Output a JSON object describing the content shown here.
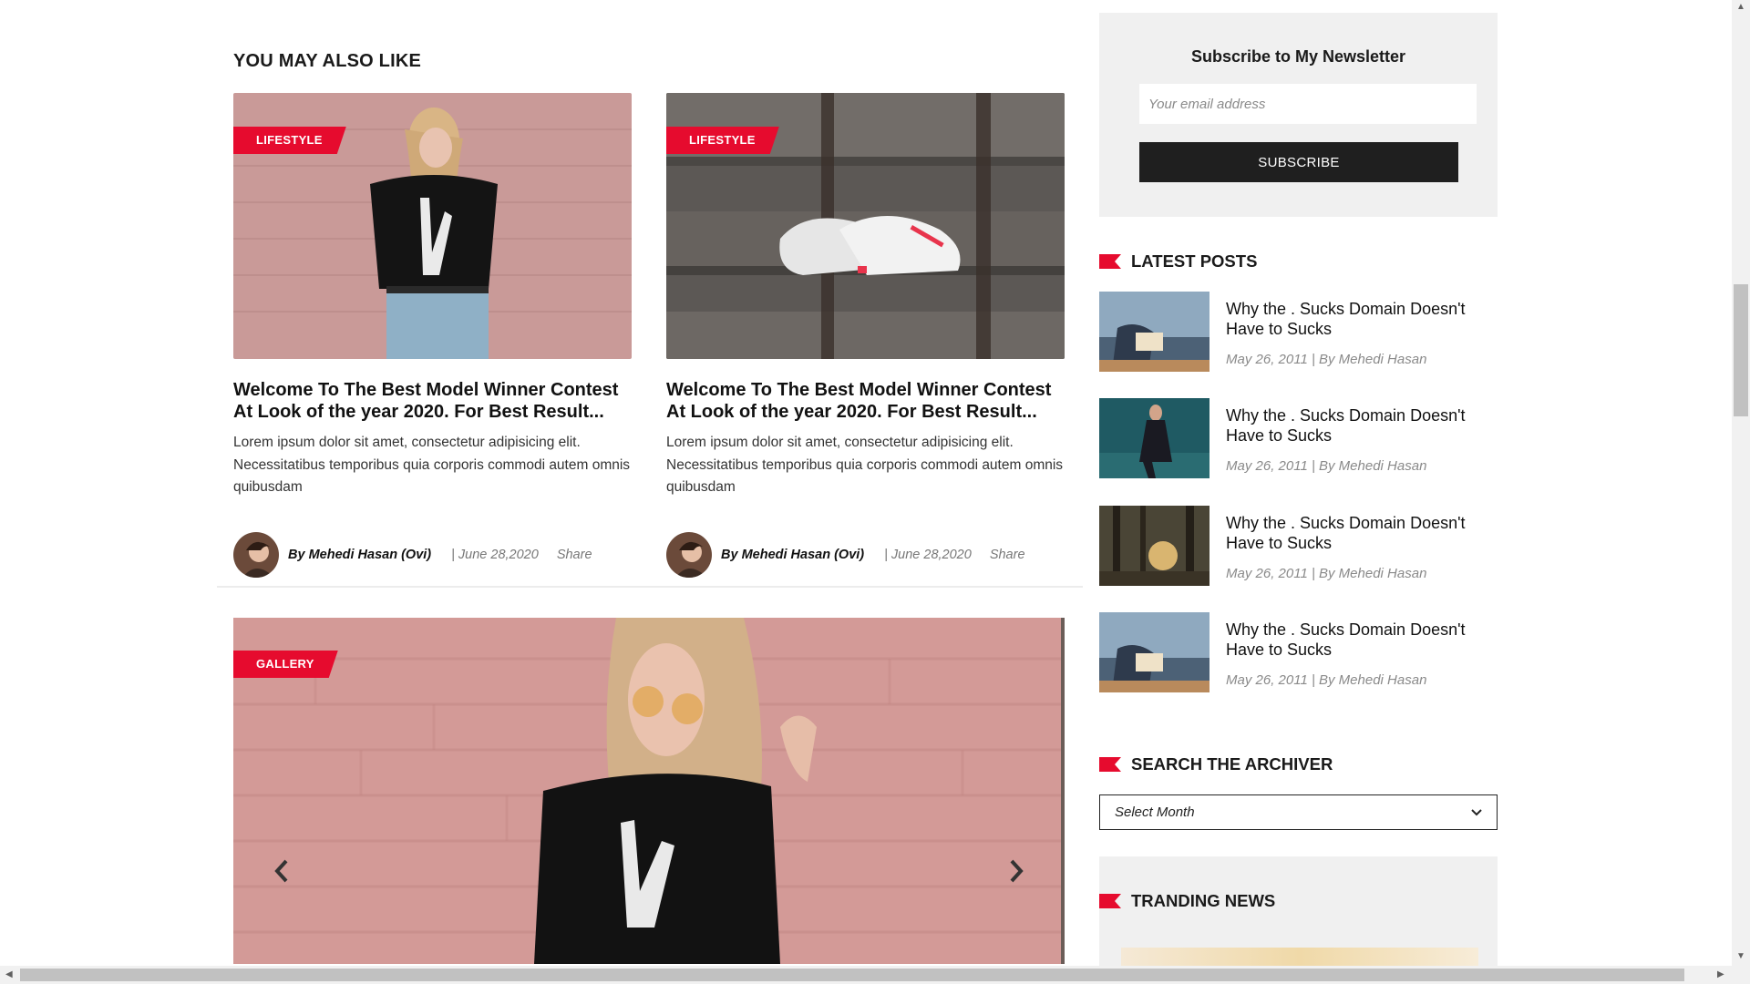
{
  "related": {
    "heading": "YOU MAY ALSO LIKE",
    "cards": [
      {
        "category": "LIFESTYLE",
        "title": "Welcome To The Best Model Winner Contest At Look of the year 2020. For Best Result...",
        "excerpt": "Lorem ipsum dolor sit amet, consectetur adipisicing elit. Necessitatibus temporibus quia corporis commodi autem omnis quibusdam",
        "author": "By Mehedi Hasan (Ovi)",
        "date": "| June 28,2020",
        "share": "Share"
      },
      {
        "category": "LIFESTYLE",
        "title": "Welcome To The Best Model Winner Contest At Look of the year 2020. For Best Result...",
        "excerpt": "Lorem ipsum dolor sit amet, consectetur adipisicing elit. Necessitatibus temporibus quia corporis commodi autem omnis quibusdam",
        "author": "By Mehedi Hasan (Ovi)",
        "date": "| June 28,2020",
        "share": "Share"
      }
    ]
  },
  "gallery": {
    "category": "GALLERY",
    "prev_icon": "chevron-left-icon",
    "next_icon": "chevron-right-icon"
  },
  "newsletter": {
    "title": "Subscribe to My Newsletter",
    "email_placeholder": "Your email address",
    "button_label": "SUBSCRIBE"
  },
  "latest_posts": {
    "title": "LATEST POSTS",
    "items": [
      {
        "title": "Why the . Sucks Domain Doesn't Have to Sucks",
        "meta": "May 26, 2011 | By Mehedi Hasan"
      },
      {
        "title": "Why the . Sucks Domain Doesn't Have to Sucks",
        "meta": "May 26, 2011 | By Mehedi Hasan"
      },
      {
        "title": "Why the . Sucks Domain Doesn't Have to Sucks",
        "meta": "May 26, 2011 | By Mehedi Hasan"
      },
      {
        "title": "Why the . Sucks Domain Doesn't Have to Sucks",
        "meta": "May 26, 2011 | By Mehedi Hasan"
      }
    ]
  },
  "archive": {
    "title": "SEARCH THE ARCHIVER",
    "selected": "Select Month"
  },
  "trending": {
    "title": "TRANDING NEWS"
  },
  "colors": {
    "accent": "#e60b2e",
    "button_dark": "#1f1f1f",
    "panel_bg": "#f0f0f0"
  }
}
